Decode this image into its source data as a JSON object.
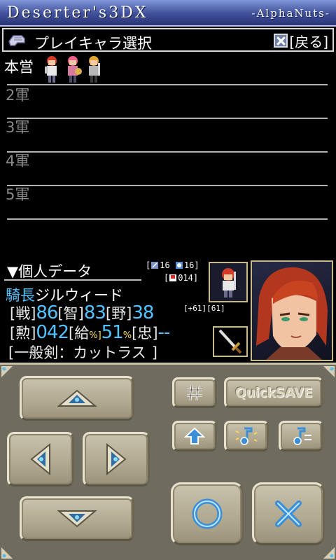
{
  "titlebar": {
    "app_name": "Deserter's3DX",
    "developer": "-AlphaNuts-"
  },
  "header": {
    "title": "プレイキャラ選択",
    "back_label": "[戻る]"
  },
  "armies": [
    {
      "label": "本営"
    },
    {
      "label": "2軍"
    },
    {
      "label": "3軍"
    },
    {
      "label": "4軍"
    },
    {
      "label": "5軍"
    }
  ],
  "personal": {
    "section_title": "▼個人データ",
    "troops_a": "16",
    "troops_b": "16",
    "food": "014",
    "rank": "騎長",
    "name": "ジルウィード",
    "war_label": "[戦]",
    "war": "86",
    "int_label": "[智]",
    "int": "83",
    "amb_label": "[野]",
    "amb": "38",
    "hp_small": "[+61][61]",
    "merit_label": "[勲]",
    "merit": "042",
    "salary_label": "[給",
    "salary": "51",
    "loyal_label": "[忠]",
    "loyal": "--",
    "weapon": "[一般剣：カットラス"
  },
  "pad": {
    "quicksave_label": "QuickSAVE"
  },
  "colors": {
    "accent_blue": "#53c3ff",
    "panel": "#6f6c5f",
    "titlebar": "#3f4f99"
  }
}
